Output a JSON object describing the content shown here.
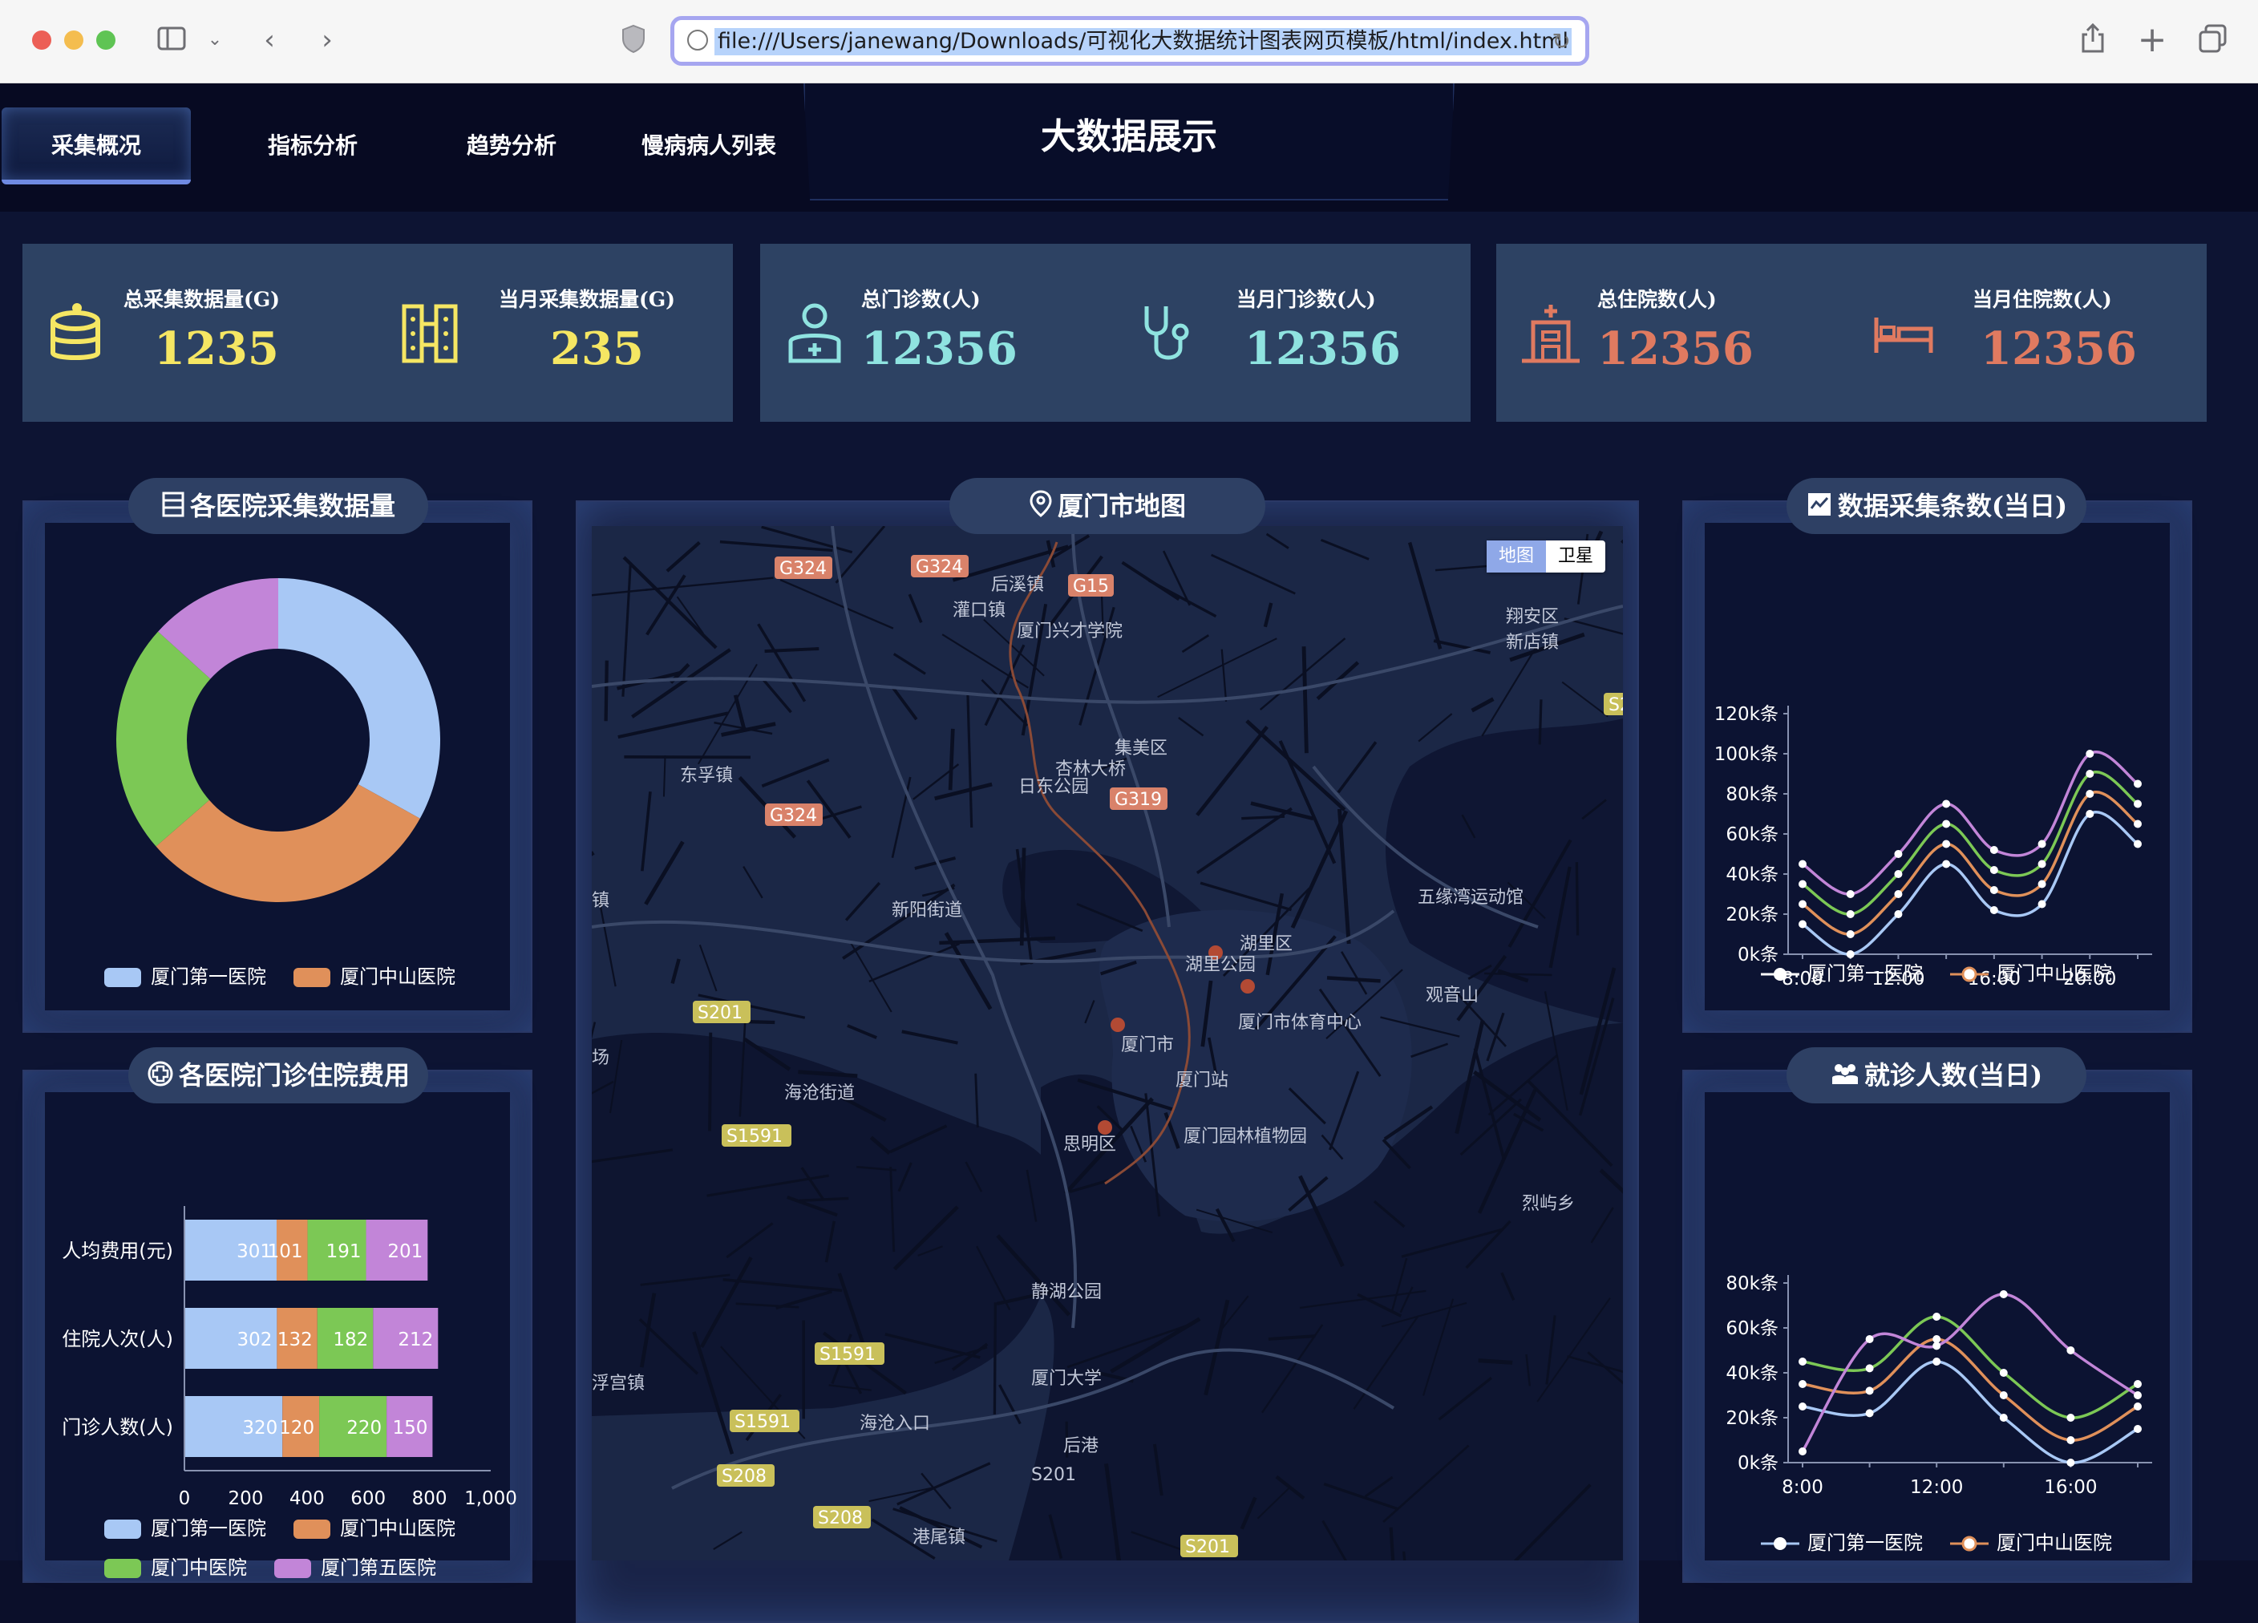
{
  "browser": {
    "url": "file:///Users/janewang/Downloads/可视化大数据统计图表网页模板/html/index.html"
  },
  "nav": {
    "tabs": [
      "采集概况",
      "指标分析",
      "趋势分析",
      "慢病病人列表"
    ],
    "active_index": 0
  },
  "title": "大数据展示",
  "stats": [
    {
      "label": "总采集数据量(G)",
      "value": "1235",
      "icon": "database-icon",
      "color": "#f5e663"
    },
    {
      "label": "当月采集数据量(G)",
      "value": "235",
      "icon": "server-rack-icon",
      "color": "#f5e663"
    },
    {
      "label": "总门诊数(人)",
      "value": "12356",
      "icon": "doctor-icon",
      "color": "#8fe3e0"
    },
    {
      "label": "当月门诊数(人)",
      "value": "12356",
      "icon": "stethoscope-icon",
      "color": "#8fe3e0"
    },
    {
      "label": "总住院数(人)",
      "value": "12356",
      "icon": "hospital-icon",
      "color": "#e07a60"
    },
    {
      "label": "当月住院数(人)",
      "value": "12356",
      "icon": "bed-icon",
      "color": "#e07a60"
    }
  ],
  "panels": {
    "hospital_data": {
      "title": "各医院采集数据量",
      "icon": "list-icon"
    },
    "map": {
      "title": "厦门市地图",
      "icon": "location-pin-icon",
      "toggle": [
        "地图",
        "卫星"
      ],
      "toggle_active": 0
    },
    "collect_count": {
      "title": "数据采集条数(当日)",
      "icon": "chart-icon"
    },
    "fees": {
      "title": "各医院门诊住院费用",
      "icon": "medical-cross-icon"
    },
    "visits": {
      "title": "就诊人数(当日)",
      "icon": "people-icon"
    }
  },
  "map_labels": [
    "G324",
    "G324",
    "后溪镇",
    "G15",
    "灌口镇",
    "厦门兴才学院",
    "翔安区",
    "新店镇",
    "集美区",
    "东孚镇",
    "杏林大桥",
    "日东公园",
    "G319",
    "G324",
    "新阳街道",
    "五缘湾运动馆",
    "湖里区",
    "湖里公园",
    "观音山",
    "厦门市体育中心",
    "厦门市",
    "厦门站",
    "S201",
    "海沧街道",
    "思明区",
    "厦门园林植物园",
    "S1591",
    "烈屿乡",
    "静湖公园",
    "S1591",
    "厦门大学",
    "S1591",
    "海沧入口",
    "后港",
    "S208",
    "S201",
    "S208",
    "港尾镇",
    "S201",
    "浮宫镇",
    "场",
    "镇",
    "S2"
  ],
  "colors": {
    "blue": "#a8c8f5",
    "orange": "#e0905a",
    "green": "#7cc855",
    "purple": "#c285d8"
  },
  "chart_data": [
    {
      "type": "pie",
      "title": "各医院采集数据量",
      "donut": true,
      "series": [
        {
          "name": "厦门第一医院",
          "value": 335
        },
        {
          "name": "厦门中山医院",
          "value": 310
        },
        {
          "name": "厦门中医院",
          "value": 234
        },
        {
          "name": "厦门第五医院",
          "value": 135
        }
      ],
      "legend_visible": [
        "厦门第一医院",
        "厦门中山医院"
      ],
      "legend": "bottom"
    },
    {
      "type": "line",
      "title": "数据采集条数(当日)",
      "x": [
        "8:00",
        "10:00",
        "12:00",
        "14:00",
        "16:00",
        "18:00",
        "20:00",
        "22:00"
      ],
      "xticks": [
        "8:00",
        "12:00",
        "16:00",
        "20:00"
      ],
      "yticks": [
        "0k条",
        "20k条",
        "40k条",
        "60k条",
        "80k条",
        "100k条",
        "120k条"
      ],
      "ylim": [
        0,
        120000
      ],
      "smooth": true,
      "series": [
        {
          "name": "厦门第一医院",
          "values": [
            15000,
            0,
            20000,
            45000,
            22000,
            25000,
            70000,
            55000
          ]
        },
        {
          "name": "厦门中山医院",
          "values": [
            25000,
            10000,
            30000,
            55000,
            32000,
            35000,
            80000,
            65000
          ]
        },
        {
          "values": [
            35000,
            20000,
            40000,
            65000,
            42000,
            45000,
            90000,
            75000
          ]
        },
        {
          "values": [
            45000,
            30000,
            50000,
            75000,
            52000,
            55000,
            100000,
            85000
          ]
        }
      ],
      "legend": "bottom"
    },
    {
      "type": "bar",
      "stacked": true,
      "orientation": "horizontal",
      "title": "各医院门诊住院费用",
      "categories": [
        "人均费用(元)",
        "住院人次(人)",
        "门诊人数(人)"
      ],
      "series": [
        {
          "name": "厦门第一医院",
          "values": [
            301,
            302,
            320
          ]
        },
        {
          "name": "厦门中山医院",
          "values": [
            101,
            132,
            120
          ]
        },
        {
          "name": "厦门中医院",
          "values": [
            191,
            182,
            220
          ]
        },
        {
          "name": "厦门第五医院",
          "values": [
            201,
            212,
            150
          ]
        }
      ],
      "xlim": [
        0,
        1000
      ],
      "xticks": [
        "0",
        "200",
        "400",
        "600",
        "800",
        "1,000"
      ],
      "legend": "bottom"
    },
    {
      "type": "line",
      "title": "就诊人数(当日)",
      "x": [
        "8:00",
        "10:00",
        "12:00",
        "14:00",
        "16:00",
        "18:00"
      ],
      "xticks": [
        "8:00",
        "12:00",
        "16:00"
      ],
      "yticks": [
        "0k条",
        "20k条",
        "40k条",
        "60k条",
        "80k条"
      ],
      "ylim": [
        0,
        80000
      ],
      "smooth": true,
      "series": [
        {
          "name": "厦门第一医院",
          "values": [
            25000,
            22000,
            45000,
            20000,
            0,
            15000
          ]
        },
        {
          "name": "厦门中山医院",
          "values": [
            35000,
            32000,
            55000,
            30000,
            10000,
            25000
          ]
        },
        {
          "values": [
            45000,
            42000,
            65000,
            40000,
            20000,
            35000
          ]
        },
        {
          "values": [
            5000,
            55000,
            52000,
            75000,
            50000,
            30000
          ]
        }
      ],
      "legend": "bottom"
    }
  ]
}
